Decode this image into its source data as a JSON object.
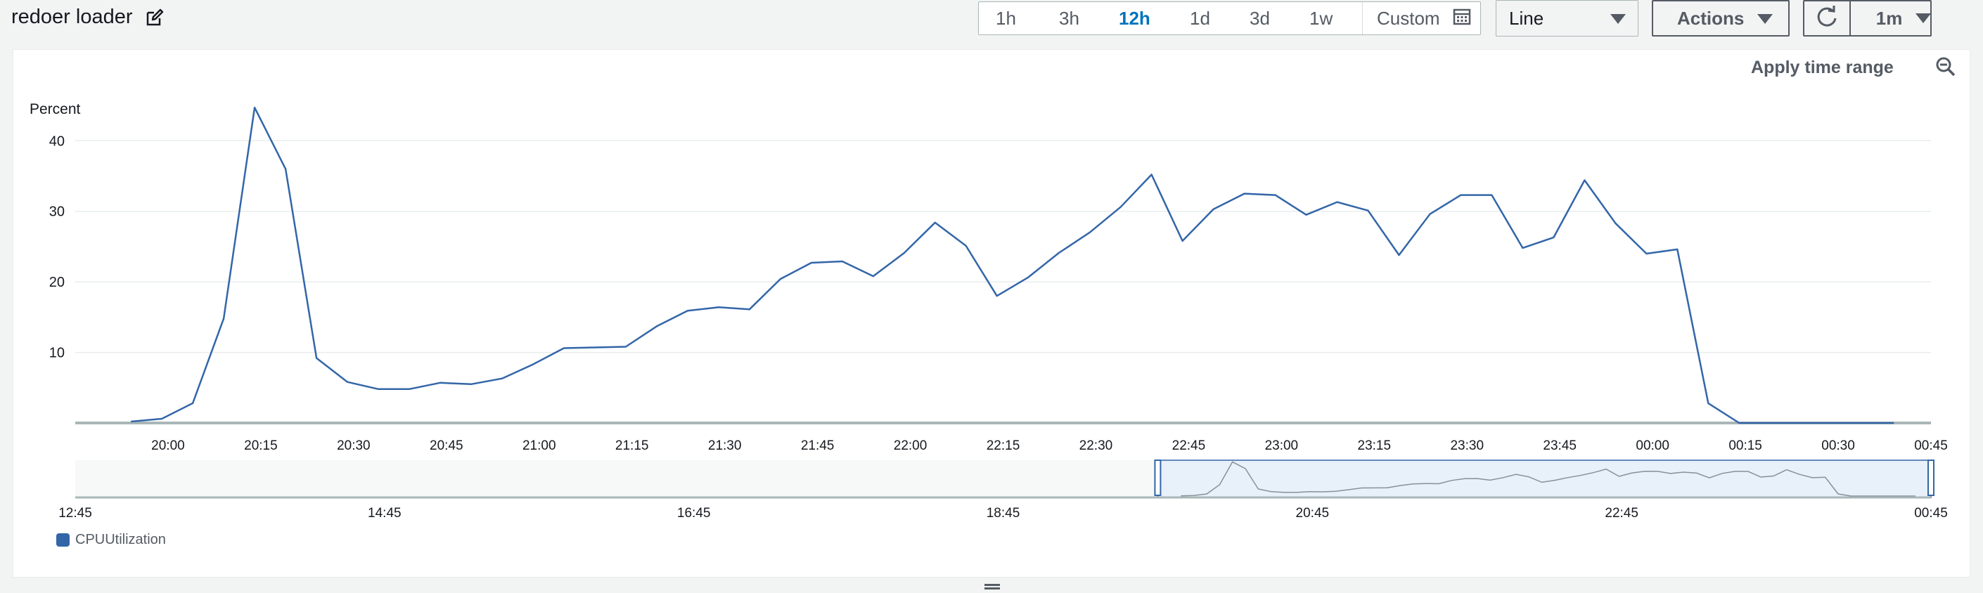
{
  "widget": {
    "title": "redoer loader"
  },
  "toolbar": {
    "ranges": [
      "1h",
      "3h",
      "12h",
      "1d",
      "3d",
      "1w"
    ],
    "active_range": "12h",
    "custom_label": "Custom",
    "chart_type": "Line",
    "actions_label": "Actions",
    "interval": "1m",
    "apply_label": "Apply time range"
  },
  "icons": [
    "edit-icon",
    "calendar-icon",
    "refresh-icon",
    "zoom-out-icon",
    "chevron-down-icon",
    "resize-handle-icon"
  ],
  "colors": {
    "series": "#3366a8",
    "accent": "#0073bb",
    "selection": "#e8f0fa"
  },
  "chart_data": {
    "type": "line",
    "ylabel": "Percent",
    "yticks": [
      10,
      20,
      30,
      40
    ],
    "ylim": [
      0,
      46
    ],
    "grid": true,
    "legend": "bottom-left",
    "x_labels": [
      "20:00",
      "20:15",
      "20:30",
      "20:45",
      "21:00",
      "21:15",
      "21:30",
      "21:45",
      "22:00",
      "22:15",
      "22:30",
      "22:45",
      "23:00",
      "23:15",
      "23:30",
      "23:45",
      "00:00",
      "00:15",
      "00:30",
      "00:45"
    ],
    "x_label_start_minutes": 1200,
    "x_label_step_minutes": 15,
    "x_domain_minutes": [
      1185,
      1485
    ],
    "series": [
      {
        "name": "CPUUtilization",
        "minutes": [
          1194,
          1199,
          1204,
          1209,
          1214,
          1219,
          1224,
          1229,
          1234,
          1239,
          1244,
          1249,
          1254,
          1259,
          1264,
          1269,
          1274,
          1279,
          1284,
          1289,
          1294,
          1299,
          1304,
          1309,
          1314,
          1319,
          1324,
          1329,
          1334,
          1339,
          1344,
          1349,
          1354,
          1359,
          1364,
          1369,
          1374,
          1379,
          1384,
          1389,
          1394,
          1399,
          1404,
          1409,
          1414,
          1419,
          1424,
          1429,
          1434,
          1439,
          1444,
          1449,
          1454,
          1459,
          1464,
          1469,
          1474,
          1479
        ],
        "values": [
          0.2,
          0.6,
          2.8,
          14.8,
          44.7,
          36,
          9.2,
          5.8,
          4.8,
          4.8,
          5.7,
          5.5,
          6.3,
          8.3,
          10.6,
          10.7,
          10.8,
          13.7,
          15.9,
          16.4,
          16.1,
          20.4,
          22.7,
          22.9,
          20.8,
          24.1,
          28.4,
          25.1,
          18,
          20.6,
          24.1,
          27,
          30.6,
          35.2,
          25.8,
          30.3,
          32.5,
          32.3,
          29.5,
          31.3,
          30.1,
          23.8,
          29.6,
          32.3,
          32.3,
          24.8,
          26.3,
          34.4,
          28.3,
          24,
          24.6,
          2.8,
          0,
          0,
          0,
          0,
          0,
          0
        ]
      }
    ],
    "navigator": {
      "x_labels": [
        "12:45",
        "14:45",
        "16:45",
        "18:45",
        "20:45",
        "22:45",
        "00:45"
      ],
      "x_label_start_minutes": 765,
      "x_label_step_minutes": 120,
      "x_domain_minutes": [
        765,
        1485
      ],
      "selection_minutes": [
        1185,
        1485
      ]
    }
  }
}
